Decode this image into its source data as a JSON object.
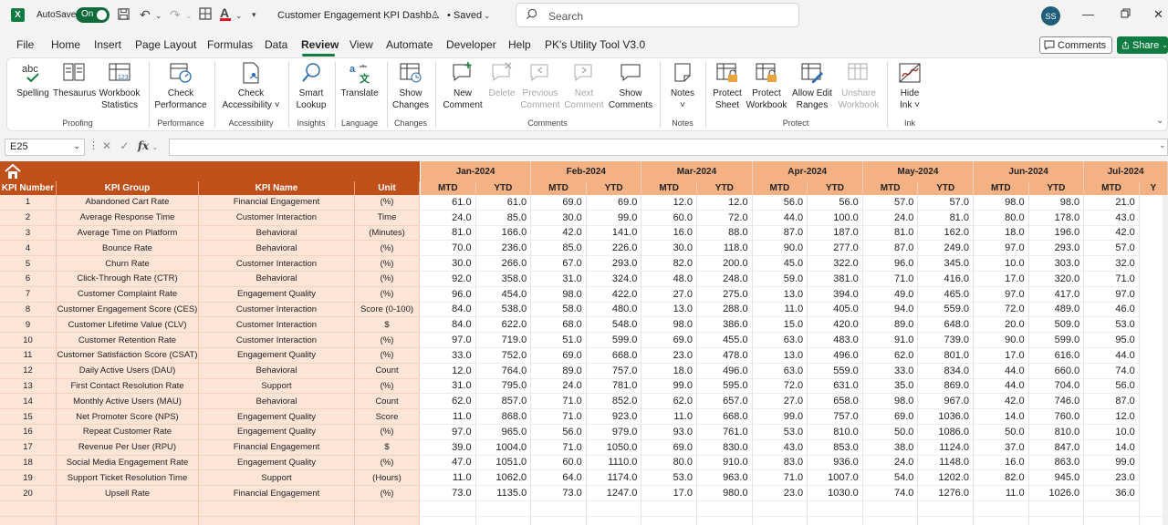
{
  "app": {
    "logo": "X",
    "autosave_label": "AutoSave",
    "autosave_state": "On",
    "doc_title": "Customer Engagement KPI Dashb...",
    "saved_status": "• Saved",
    "search_placeholder": "Search",
    "avatar_initials": "SS"
  },
  "menu": {
    "items": [
      "File",
      "Home",
      "Insert",
      "Page Layout",
      "Formulas",
      "Data",
      "Review",
      "View",
      "Automate",
      "Developer",
      "Help",
      "PK's Utility Tool V3.0"
    ],
    "active": "Review",
    "comments_label": "Comments",
    "share_label": "Share"
  },
  "ribbon": {
    "groups": {
      "proofing": "Proofing",
      "performance": "Performance",
      "accessibility": "Accessibility",
      "insights": "Insights",
      "language": "Language",
      "changes": "Changes",
      "comments": "Comments",
      "notes": "Notes",
      "protect": "Protect",
      "ink": "Ink"
    },
    "buttons": {
      "spelling": "Spelling",
      "thesaurus": "Thesaurus",
      "workbook_statistics_1": "Workbook",
      "workbook_statistics_2": "Statistics",
      "check_performance_1": "Check",
      "check_performance_2": "Performance",
      "check_accessibility_1": "Check",
      "check_accessibility_2": "Accessibility ˅",
      "smart_lookup_1": "Smart",
      "smart_lookup_2": "Lookup",
      "translate": "Translate",
      "show_changes_1": "Show",
      "show_changes_2": "Changes",
      "new_comment_1": "New",
      "new_comment_2": "Comment",
      "delete": "Delete",
      "previous_comment_1": "Previous",
      "previous_comment_2": "Comment",
      "next_comment_1": "Next",
      "next_comment_2": "Comment",
      "show_comments_1": "Show",
      "show_comments_2": "Comments",
      "notes_1": "Notes",
      "notes_2": "˅",
      "protect_sheet_1": "Protect",
      "protect_sheet_2": "Sheet",
      "protect_workbook_1": "Protect",
      "protect_workbook_2": "Workbook",
      "allow_edit_ranges_1": "Allow Edit",
      "allow_edit_ranges_2": "Ranges",
      "unshare_workbook_1": "Unshare",
      "unshare_workbook_2": "Workbook",
      "hide_ink_1": "Hide",
      "hide_ink_2": "Ink ˅"
    }
  },
  "formula_bar": {
    "name_box": "E25",
    "fx": "fx",
    "value": ""
  },
  "sheet": {
    "accent_dark": "#c0501a",
    "accent_light": "#f4b183",
    "row_fill": "#fce4d6",
    "headers": [
      "KPI Number",
      "KPI Group",
      "KPI Name",
      "Unit"
    ],
    "months": [
      "Jan-2024",
      "Feb-2024",
      "Mar-2024",
      "Apr-2024",
      "May-2024",
      "Jun-2024",
      "Jul-2024"
    ],
    "sub_headers": [
      "MTD",
      "YTD"
    ],
    "rows": [
      {
        "num": "1",
        "group": "Abandoned Cart Rate",
        "name": "Financial Engagement",
        "unit": "(%)",
        "vals": [
          "61.0",
          "61.0",
          "69.0",
          "69.0",
          "12.0",
          "12.0",
          "56.0",
          "56.0",
          "57.0",
          "57.0",
          "98.0",
          "98.0",
          "21.0"
        ]
      },
      {
        "num": "2",
        "group": "Average Response Time",
        "name": "Customer Interaction",
        "unit": "Time",
        "vals": [
          "24.0",
          "85.0",
          "30.0",
          "99.0",
          "60.0",
          "72.0",
          "44.0",
          "100.0",
          "24.0",
          "81.0",
          "80.0",
          "178.0",
          "43.0"
        ]
      },
      {
        "num": "3",
        "group": "Average Time on Platform",
        "name": "Behavioral",
        "unit": "(Minutes)",
        "vals": [
          "81.0",
          "166.0",
          "42.0",
          "141.0",
          "16.0",
          "88.0",
          "87.0",
          "187.0",
          "81.0",
          "162.0",
          "18.0",
          "196.0",
          "42.0"
        ]
      },
      {
        "num": "4",
        "group": "Bounce Rate",
        "name": "Behavioral",
        "unit": "(%)",
        "vals": [
          "70.0",
          "236.0",
          "85.0",
          "226.0",
          "30.0",
          "118.0",
          "90.0",
          "277.0",
          "87.0",
          "249.0",
          "97.0",
          "293.0",
          "57.0"
        ]
      },
      {
        "num": "5",
        "group": "Churn Rate",
        "name": "Customer Interaction",
        "unit": "(%)",
        "vals": [
          "30.0",
          "266.0",
          "67.0",
          "293.0",
          "82.0",
          "200.0",
          "45.0",
          "322.0",
          "96.0",
          "345.0",
          "10.0",
          "303.0",
          "32.0"
        ]
      },
      {
        "num": "6",
        "group": "Click-Through Rate (CTR)",
        "name": "Behavioral",
        "unit": "(%)",
        "vals": [
          "92.0",
          "358.0",
          "31.0",
          "324.0",
          "48.0",
          "248.0",
          "59.0",
          "381.0",
          "71.0",
          "416.0",
          "17.0",
          "320.0",
          "71.0"
        ]
      },
      {
        "num": "7",
        "group": "Customer Complaint Rate",
        "name": "Engagement Quality",
        "unit": "(%)",
        "vals": [
          "96.0",
          "454.0",
          "98.0",
          "422.0",
          "27.0",
          "275.0",
          "13.0",
          "394.0",
          "49.0",
          "465.0",
          "97.0",
          "417.0",
          "97.0"
        ]
      },
      {
        "num": "8",
        "group": "Customer Engagement Score (CES)",
        "name": "Customer Interaction",
        "unit": "Score (0-100)",
        "vals": [
          "84.0",
          "538.0",
          "58.0",
          "480.0",
          "13.0",
          "288.0",
          "11.0",
          "405.0",
          "94.0",
          "559.0",
          "72.0",
          "489.0",
          "46.0"
        ]
      },
      {
        "num": "9",
        "group": "Customer Lifetime Value (CLV)",
        "name": "Customer Interaction",
        "unit": "$",
        "vals": [
          "84.0",
          "622.0",
          "68.0",
          "548.0",
          "98.0",
          "386.0",
          "15.0",
          "420.0",
          "89.0",
          "648.0",
          "20.0",
          "509.0",
          "53.0"
        ]
      },
      {
        "num": "10",
        "group": "Customer Retention Rate",
        "name": "Customer Interaction",
        "unit": "(%)",
        "vals": [
          "97.0",
          "719.0",
          "51.0",
          "599.0",
          "69.0",
          "455.0",
          "63.0",
          "483.0",
          "91.0",
          "739.0",
          "90.0",
          "599.0",
          "95.0"
        ]
      },
      {
        "num": "11",
        "group": "Customer Satisfaction Score (CSAT)",
        "name": "Engagement Quality",
        "unit": "(%)",
        "vals": [
          "33.0",
          "752.0",
          "69.0",
          "668.0",
          "23.0",
          "478.0",
          "13.0",
          "496.0",
          "62.0",
          "801.0",
          "17.0",
          "616.0",
          "44.0"
        ]
      },
      {
        "num": "12",
        "group": "Daily Active Users (DAU)",
        "name": "Behavioral",
        "unit": "Count",
        "vals": [
          "12.0",
          "764.0",
          "89.0",
          "757.0",
          "18.0",
          "496.0",
          "63.0",
          "559.0",
          "33.0",
          "834.0",
          "44.0",
          "660.0",
          "74.0"
        ]
      },
      {
        "num": "13",
        "group": "First Contact Resolution Rate",
        "name": "Support",
        "unit": "(%)",
        "vals": [
          "31.0",
          "795.0",
          "24.0",
          "781.0",
          "99.0",
          "595.0",
          "72.0",
          "631.0",
          "35.0",
          "869.0",
          "44.0",
          "704.0",
          "56.0"
        ]
      },
      {
        "num": "14",
        "group": "Monthly Active Users (MAU)",
        "name": "Behavioral",
        "unit": "Count",
        "vals": [
          "62.0",
          "857.0",
          "71.0",
          "852.0",
          "62.0",
          "657.0",
          "27.0",
          "658.0",
          "98.0",
          "967.0",
          "42.0",
          "746.0",
          "87.0"
        ]
      },
      {
        "num": "15",
        "group": "Net Promoter Score (NPS)",
        "name": "Engagement Quality",
        "unit": "Score",
        "vals": [
          "11.0",
          "868.0",
          "71.0",
          "923.0",
          "11.0",
          "668.0",
          "99.0",
          "757.0",
          "69.0",
          "1036.0",
          "14.0",
          "760.0",
          "12.0"
        ]
      },
      {
        "num": "16",
        "group": "Repeat Customer Rate",
        "name": "Engagement Quality",
        "unit": "(%)",
        "vals": [
          "97.0",
          "965.0",
          "56.0",
          "979.0",
          "93.0",
          "761.0",
          "53.0",
          "810.0",
          "50.0",
          "1086.0",
          "50.0",
          "810.0",
          "10.0"
        ]
      },
      {
        "num": "17",
        "group": "Revenue Per User (RPU)",
        "name": "Financial Engagement",
        "unit": "$",
        "vals": [
          "39.0",
          "1004.0",
          "71.0",
          "1050.0",
          "69.0",
          "830.0",
          "43.0",
          "853.0",
          "38.0",
          "1124.0",
          "37.0",
          "847.0",
          "14.0"
        ]
      },
      {
        "num": "18",
        "group": "Social Media Engagement Rate",
        "name": "Engagement Quality",
        "unit": "(%)",
        "vals": [
          "47.0",
          "1051.0",
          "60.0",
          "1110.0",
          "80.0",
          "910.0",
          "83.0",
          "936.0",
          "24.0",
          "1148.0",
          "16.0",
          "863.0",
          "99.0"
        ]
      },
      {
        "num": "19",
        "group": "Support Ticket Resolution Time",
        "name": "Support",
        "unit": "(Hours)",
        "vals": [
          "11.0",
          "1062.0",
          "64.0",
          "1174.0",
          "53.0",
          "963.0",
          "71.0",
          "1007.0",
          "54.0",
          "1202.0",
          "82.0",
          "945.0",
          "23.0"
        ]
      },
      {
        "num": "20",
        "group": "Upsell Rate",
        "name": "Financial Engagement",
        "unit": "(%)",
        "vals": [
          "73.0",
          "1135.0",
          "73.0",
          "1247.0",
          "17.0",
          "980.0",
          "23.0",
          "1030.0",
          "74.0",
          "1276.0",
          "11.0",
          "1026.0",
          "36.0"
        ]
      }
    ],
    "overflow_label": "Y"
  }
}
